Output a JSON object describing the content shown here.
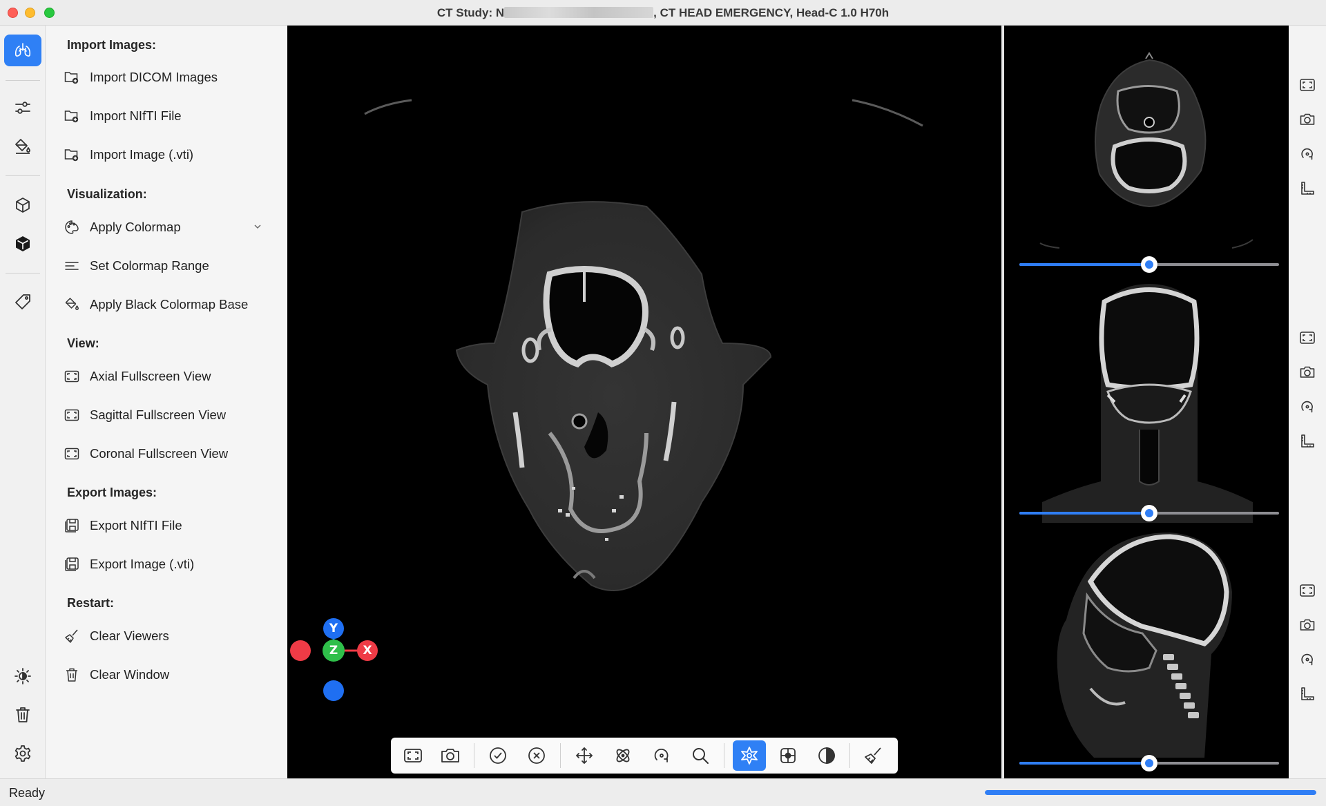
{
  "window": {
    "title_prefix": "CT Study: N",
    "title_suffix": ", CT  HEAD EMERGENCY, Head-C  1.0  H70h"
  },
  "sidebar": {
    "sections": [
      {
        "heading": "Import Images:",
        "items": [
          {
            "label": "Import DICOM Images",
            "icon": "folder-plus-icon"
          },
          {
            "label": "Import NIfTI File",
            "icon": "folder-plus-icon"
          },
          {
            "label": "Import Image (.vti)",
            "icon": "folder-plus-icon"
          }
        ]
      },
      {
        "heading": "Visualization:",
        "items": [
          {
            "label": "Apply Colormap",
            "icon": "palette-icon",
            "has_dropdown": true
          },
          {
            "label": "Set Colormap Range",
            "icon": "lines-icon"
          },
          {
            "label": "Apply Black Colormap Base",
            "icon": "paint-bucket-icon"
          }
        ]
      },
      {
        "heading": "View:",
        "items": [
          {
            "label": "Axial Fullscreen View",
            "icon": "fullscreen-icon"
          },
          {
            "label": "Sagittal Fullscreen View",
            "icon": "fullscreen-icon"
          },
          {
            "label": "Coronal Fullscreen View",
            "icon": "fullscreen-icon"
          }
        ]
      },
      {
        "heading": "Export Images:",
        "items": [
          {
            "label": "Export NIfTI File",
            "icon": "save-icon"
          },
          {
            "label": "Export Image (.vti)",
            "icon": "save-icon"
          }
        ]
      },
      {
        "heading": "Restart:",
        "items": [
          {
            "label": "Clear Viewers",
            "icon": "broom-icon"
          },
          {
            "label": "Clear Window",
            "icon": "trash-icon"
          }
        ]
      }
    ]
  },
  "orientation": {
    "x": "X",
    "y": "Y",
    "z": "Z"
  },
  "slices": [
    {
      "view": "axial",
      "level": 0.5
    },
    {
      "view": "coronal",
      "level": 0.5
    },
    {
      "view": "sagittal",
      "level": 0.5
    }
  ],
  "status": {
    "text": "Ready",
    "progress": 1.0
  },
  "colors": {
    "accent": "#2f80f5",
    "x_axis": "#ef3b46",
    "y_axis": "#1f6ff2",
    "z_axis": "#2fbf4a"
  }
}
